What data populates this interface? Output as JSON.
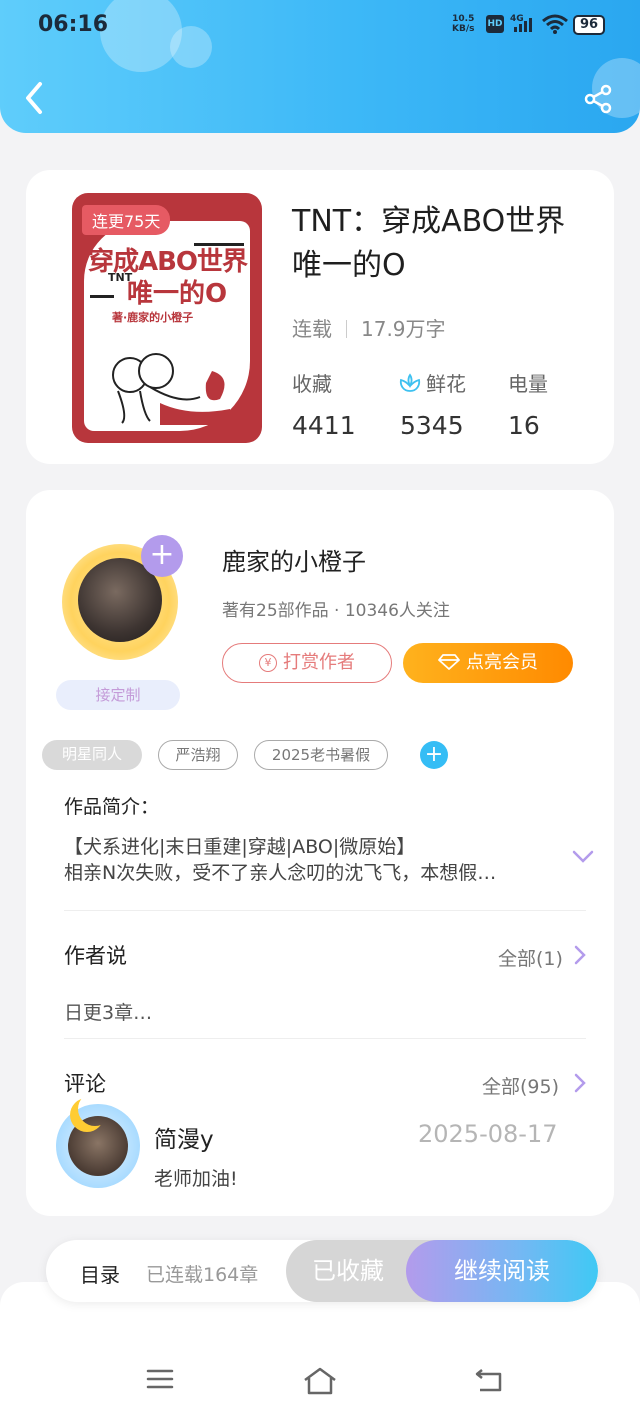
{
  "status_bar": {
    "time": "06:16",
    "speed_value": "10.5",
    "speed_unit": "KB/s",
    "hd": "HD",
    "network": "4G",
    "battery": "96"
  },
  "header": {
    "back_icon": "chevron-left-icon",
    "share_icon": "share-icon"
  },
  "book": {
    "cover": {
      "tag": "连更75天",
      "title_line1": "穿成ABO世界",
      "title_tnt": "TNT",
      "title_line2": "唯一的O",
      "author_line": "著·鹿家的小橙子"
    },
    "title": "TNT：穿成ABO世界唯一的O",
    "status": "连载",
    "word_count": "17.9万字",
    "stats": [
      {
        "label": "收藏",
        "value": "4411"
      },
      {
        "label": "鲜花",
        "value": "5345",
        "icon": "flower-icon"
      },
      {
        "label": "电量",
        "value": "16"
      }
    ]
  },
  "author": {
    "name": "鹿家的小橙子",
    "info": "著有25部作品 · 10346人关注",
    "custom_tag": "接定制",
    "tip_button": "打赏作者",
    "tip_icon": "yen-icon",
    "vip_button": "点亮会员",
    "vip_icon": "diamond-icon",
    "follow_icon": "plus-icon"
  },
  "tags": [
    "明星同人",
    "严浩翔",
    "2025老书暑假"
  ],
  "intro": {
    "title": "作品简介：",
    "line1": "【犬系进化|末日重建|穿越|ABO|微原始】",
    "line2": "相亲N次失败，受不了亲人念叨的沈飞飞，本想假…"
  },
  "author_says": {
    "title": "作者说",
    "all": "全部(1)",
    "text": "日更3章…"
  },
  "comments": {
    "title": "评论",
    "all": "全部(95)",
    "items": [
      {
        "user": "简漫y",
        "date": "2025-08-17",
        "text": "老师加油!"
      }
    ]
  },
  "bottom_bar": {
    "toc": "目录",
    "chapters": "已连载164章",
    "collected": "已收藏",
    "continue": "继续阅读"
  },
  "nav_bar": {
    "menu_icon": "menu-icon",
    "home_icon": "home-icon",
    "back_icon": "back-icon"
  },
  "colors": {
    "accent_blue": "#3db8f7",
    "vip_orange": "#ff8a00",
    "tip_red": "#e57b7b",
    "cover_red": "#b8363c"
  }
}
